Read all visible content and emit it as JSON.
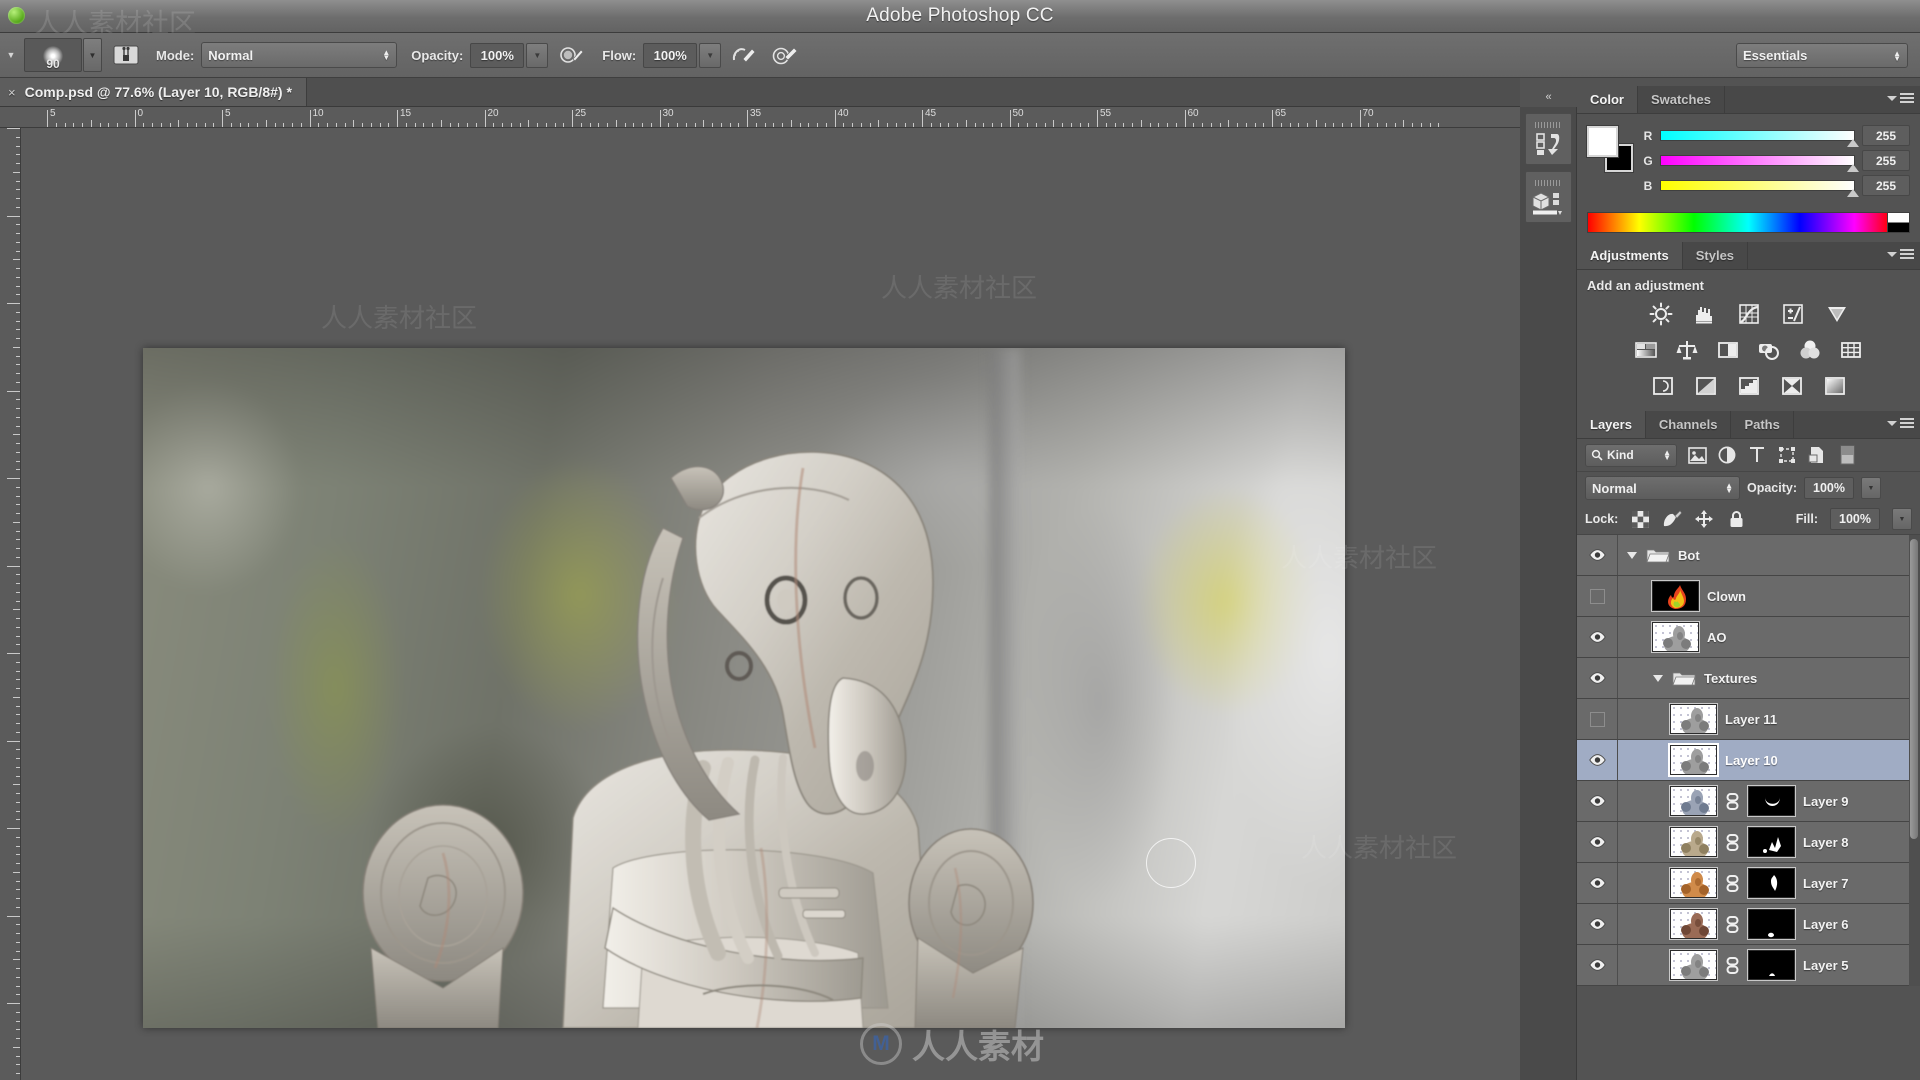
{
  "app": {
    "title": "Adobe Photoshop CC"
  },
  "options_bar": {
    "brush_size": "90",
    "mode_label": "Mode:",
    "mode_value": "Normal",
    "opacity_label": "Opacity:",
    "opacity_value": "100%",
    "flow_label": "Flow:",
    "flow_value": "100%",
    "brush_panel_icon": "brush-panel-icon",
    "airbrush_icon": "airbrush-icon",
    "tablet_pressure_opacity_icon": "tablet-pressure-opacity-icon",
    "tablet_pressure_size_icon": "tablet-pressure-size-icon",
    "workspace": "Essentials"
  },
  "document": {
    "tab_title": "Comp.psd @ 77.6% (Layer 10, RGB/8#) *",
    "close_glyph": "×",
    "zoom": "77.6%",
    "mode": "RGB/8#",
    "active_layer": "Layer 10",
    "filename": "Comp.psd",
    "modified": true
  },
  "rulers": {
    "unit_labels": [
      "5",
      "0",
      "5",
      "10",
      "15",
      "20",
      "25",
      "30",
      "35",
      "40",
      "45",
      "50",
      "55",
      "60",
      "65",
      "70"
    ]
  },
  "collapsed_dock": {
    "collapse_glyph": "«",
    "items": [
      {
        "name": "history-panel-icon"
      },
      {
        "name": "3d-panel-icon"
      }
    ]
  },
  "color_panel": {
    "tabs": [
      {
        "label": "Color",
        "active": true
      },
      {
        "label": "Swatches",
        "active": false
      }
    ],
    "foreground": "#ffffff",
    "background": "#000000",
    "channels": [
      {
        "label": "R",
        "value": "255"
      },
      {
        "label": "G",
        "value": "255"
      },
      {
        "label": "B",
        "value": "255"
      }
    ]
  },
  "adjustments_panel": {
    "tabs": [
      {
        "label": "Adjustments",
        "active": true
      },
      {
        "label": "Styles",
        "active": false
      }
    ],
    "heading": "Add an adjustment",
    "rows": [
      [
        "brightness-contrast-icon",
        "levels-icon",
        "curves-icon",
        "exposure-icon",
        "vibrance-icon"
      ],
      [
        "hue-saturation-icon",
        "color-balance-icon",
        "black-white-icon",
        "photo-filter-icon",
        "channel-mixer-icon",
        "color-lookup-icon"
      ],
      [
        "invert-icon",
        "posterize-icon",
        "threshold-icon",
        "selective-color-icon",
        "gradient-map-icon"
      ]
    ]
  },
  "layers_panel": {
    "tabs": [
      {
        "label": "Layers",
        "active": true
      },
      {
        "label": "Channels",
        "active": false
      },
      {
        "label": "Paths",
        "active": false
      }
    ],
    "filter": {
      "kind_label": "Kind",
      "search_icon": "search-icon",
      "filter_icons": [
        "pixel-layer-filter-icon",
        "adjustment-layer-filter-icon",
        "type-layer-filter-icon",
        "shape-layer-filter-icon",
        "smart-object-filter-icon",
        "filter-toggle-switch"
      ]
    },
    "blend_mode": "Normal",
    "opacity_label": "Opacity:",
    "opacity_value": "100%",
    "lock_label": "Lock:",
    "lock_icons": [
      "lock-transparency-icon",
      "lock-image-pixels-icon",
      "lock-position-icon",
      "lock-all-icon"
    ],
    "fill_label": "Fill:",
    "fill_value": "100%",
    "layers": [
      {
        "name": "Bot",
        "type": "group",
        "visible": true,
        "indent": 0,
        "expanded": true,
        "selected": false,
        "has_mask": false
      },
      {
        "name": "Clown",
        "type": "raster",
        "visible": false,
        "indent": 1,
        "selected": false,
        "has_mask": false,
        "thumb": "fire"
      },
      {
        "name": "AO",
        "type": "raster",
        "visible": true,
        "indent": 1,
        "selected": false,
        "has_mask": false,
        "thumb": "figure-gray"
      },
      {
        "name": "Textures",
        "type": "group",
        "visible": true,
        "indent": 1,
        "expanded": true,
        "selected": false,
        "has_mask": false
      },
      {
        "name": "Layer 11",
        "type": "raster",
        "visible": false,
        "indent": 2,
        "selected": false,
        "has_mask": false,
        "thumb": "figure-gray"
      },
      {
        "name": "Layer 10",
        "type": "raster",
        "visible": true,
        "indent": 2,
        "selected": true,
        "has_mask": false,
        "thumb": "figure-gray"
      },
      {
        "name": "Layer 9",
        "type": "raster",
        "visible": true,
        "indent": 2,
        "selected": false,
        "has_mask": true,
        "thumb": "figure-blue",
        "mask": "crescent"
      },
      {
        "name": "Layer 8",
        "type": "raster",
        "visible": true,
        "indent": 2,
        "selected": false,
        "has_mask": true,
        "thumb": "figure-tan",
        "mask": "splotch"
      },
      {
        "name": "Layer 7",
        "type": "raster",
        "visible": true,
        "indent": 2,
        "selected": false,
        "has_mask": true,
        "thumb": "figure-orange",
        "mask": "flame"
      },
      {
        "name": "Layer 6",
        "type": "raster",
        "visible": true,
        "indent": 2,
        "selected": false,
        "has_mask": true,
        "thumb": "figure-brown",
        "mask": "dot"
      },
      {
        "name": "Layer 5",
        "type": "raster",
        "visible": true,
        "indent": 2,
        "selected": false,
        "has_mask": true,
        "thumb": "figure-gray",
        "mask": "small"
      }
    ]
  },
  "canvas": {
    "image_description": "weathered white-washed robot statue in blurred industrial background",
    "brush_cursor": "brush-cursor-circle"
  },
  "watermark": {
    "text": "人人素材",
    "logo_letter": "M",
    "corner_text": "人人素材社区"
  },
  "colors": {
    "chrome": "#535353",
    "panel": "#6a6a6a",
    "selection": "#a0acc4",
    "accent_blue": "#2f66c4"
  }
}
